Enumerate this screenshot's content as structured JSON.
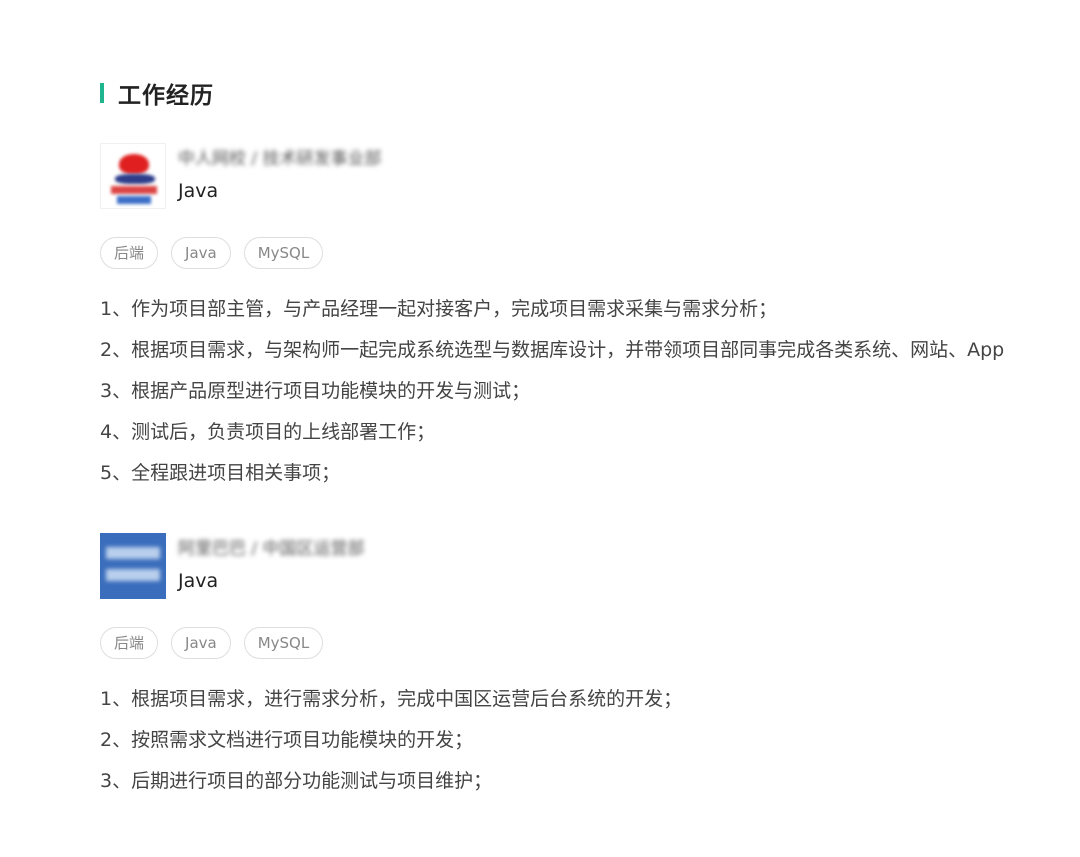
{
  "section": {
    "title": "工作经历",
    "accent_color": "#1fb58f"
  },
  "jobs": [
    {
      "logo_icon": "company-logo-red-blue",
      "company": "中人网校 / 技术研发事业部",
      "position": "Java",
      "tags": [
        "后端",
        "Java",
        "MySQL"
      ],
      "duties": [
        "1、作为项目部主管，与产品经理一起对接客户，完成项目需求采集与需求分析；",
        "2、根据项目需求，与架构师一起完成系统选型与数据库设计，并带领项目部同事完成各类系统、网站、App",
        "3、根据产品原型进行项目功能模块的开发与测试；",
        "4、测试后，负责项目的上线部署工作；",
        "5、全程跟进项目相关事项；"
      ]
    },
    {
      "logo_icon": "company-logo-blue",
      "company": "阿里巴巴 / 中国区运营部",
      "position": "Java",
      "tags": [
        "后端",
        "Java",
        "MySQL"
      ],
      "duties": [
        "1、根据项目需求，进行需求分析，完成中国区运营后台系统的开发；",
        "2、按照需求文档进行项目功能模块的开发；",
        "3、后期进行项目的部分功能测试与项目维护；"
      ]
    }
  ]
}
